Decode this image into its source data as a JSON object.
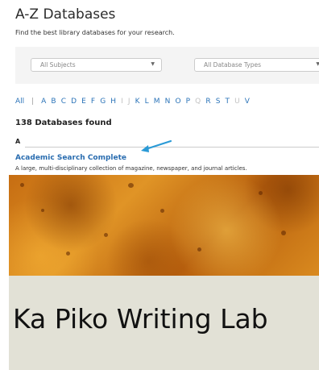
{
  "header": {
    "title": "A-Z Databases",
    "subtitle": "Find the best library databases for your research."
  },
  "filters": {
    "subjects": "All Subjects",
    "types": "All Database Types"
  },
  "alphabet": {
    "all": "All",
    "separator": "|",
    "letters": [
      {
        "letter": "A",
        "enabled": true
      },
      {
        "letter": "B",
        "enabled": true
      },
      {
        "letter": "C",
        "enabled": true
      },
      {
        "letter": "D",
        "enabled": true
      },
      {
        "letter": "E",
        "enabled": true
      },
      {
        "letter": "F",
        "enabled": true
      },
      {
        "letter": "G",
        "enabled": true
      },
      {
        "letter": "H",
        "enabled": true
      },
      {
        "letter": "I",
        "enabled": false
      },
      {
        "letter": "J",
        "enabled": false
      },
      {
        "letter": "K",
        "enabled": true
      },
      {
        "letter": "L",
        "enabled": true
      },
      {
        "letter": "M",
        "enabled": true
      },
      {
        "letter": "N",
        "enabled": true
      },
      {
        "letter": "O",
        "enabled": true
      },
      {
        "letter": "P",
        "enabled": true
      },
      {
        "letter": "Q",
        "enabled": false
      },
      {
        "letter": "R",
        "enabled": true
      },
      {
        "letter": "S",
        "enabled": true
      },
      {
        "letter": "T",
        "enabled": true
      },
      {
        "letter": "U",
        "enabled": false
      },
      {
        "letter": "V",
        "enabled": true
      }
    ]
  },
  "results": {
    "count": "138 Databases found",
    "section": "A",
    "first_title": "Academic Search Complete",
    "first_desc": "A large, multi-disciplinary collection of magazine, newspaper, and journal articles."
  },
  "lab": {
    "title": "Ka Piko Writing Lab"
  },
  "colors": {
    "link": "#2a6db0",
    "arrow": "#2a9ad6",
    "panel": "#e2e1d6"
  },
  "icons": {
    "annotation": "arrow-icon",
    "dropdown": "caret-down-icon"
  }
}
